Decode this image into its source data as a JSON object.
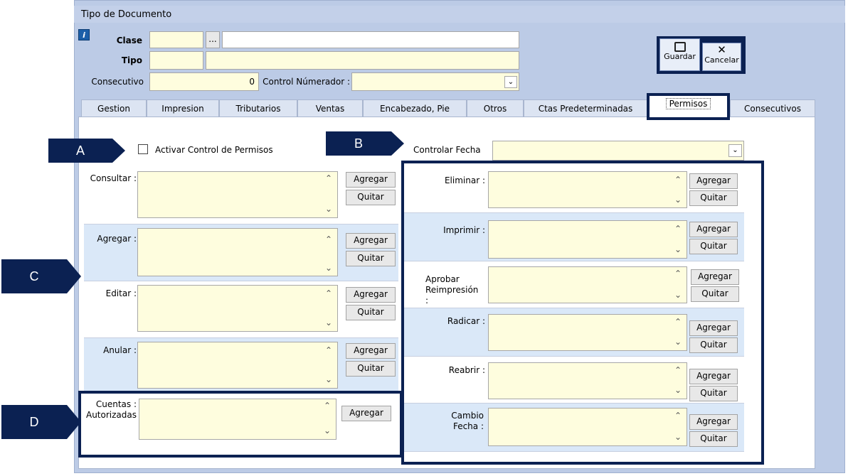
{
  "window": {
    "title": "Tipo de Documento"
  },
  "header": {
    "clase_label": "Clase",
    "tipo_label": "Tipo",
    "consecutivo_label": "Consecutivo",
    "consecutivo_value": "0",
    "control_label": "Control Númerador :",
    "browse_label": "..."
  },
  "toolbar": {
    "guardar": "Guardar",
    "cancelar": "Cancelar"
  },
  "tabs": [
    {
      "label": "Gestion"
    },
    {
      "label": "Impresion"
    },
    {
      "label": "Tributarios"
    },
    {
      "label": "Ventas"
    },
    {
      "label": "Encabezado, Pie"
    },
    {
      "label": "Otros"
    },
    {
      "label": "Ctas Predeterminadas"
    },
    {
      "label": "Permisos"
    },
    {
      "label": "Consecutivos"
    }
  ],
  "permisos": {
    "activar_label": "Activar Control de Permisos",
    "controlar_fecha_label": "Controlar Fecha",
    "agregar": "Agregar",
    "quitar": "Quitar",
    "left_rows": [
      {
        "label": "Consultar :"
      },
      {
        "label": "Agregar :"
      },
      {
        "label": "Editar :"
      },
      {
        "label": "Anular :"
      }
    ],
    "right_rows": [
      {
        "label": "Eliminar :"
      },
      {
        "label": "Imprimir :"
      },
      {
        "label": "Aprobar Reimpresión :"
      },
      {
        "label": "Radicar :"
      },
      {
        "label": "Reabrir :"
      },
      {
        "label": "Cambio Fecha :"
      }
    ],
    "cuentas_label_1": "Cuentas :",
    "cuentas_label_2": "Autorizadas"
  },
  "annotations": [
    "A",
    "B",
    "C",
    "D"
  ],
  "colors": {
    "annotation": "#0b2152",
    "field": "#fefdde",
    "row_blue": "#dae8f8"
  }
}
